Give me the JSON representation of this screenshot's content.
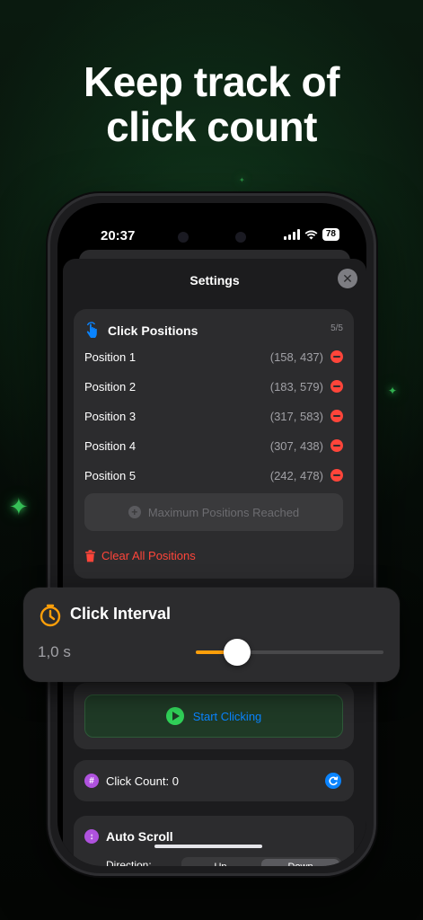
{
  "headline": {
    "line1": "Keep track of",
    "line2": "click count"
  },
  "status_bar": {
    "time": "20:37",
    "battery": "78"
  },
  "sheet": {
    "title": "Settings",
    "close_label": "✕"
  },
  "click_positions": {
    "title": "Click Positions",
    "count": "5/5",
    "items": [
      {
        "label": "Position 1",
        "coords": "(158, 437)"
      },
      {
        "label": "Position 2",
        "coords": "(183, 579)"
      },
      {
        "label": "Position 3",
        "coords": "(317, 583)"
      },
      {
        "label": "Position 4",
        "coords": "(307, 438)"
      },
      {
        "label": "Position 5",
        "coords": "(242, 478)"
      }
    ],
    "max_button": "Maximum Positions Reached",
    "clear_label": "Clear All Positions"
  },
  "start_button": {
    "label": "Start Clicking"
  },
  "click_count": {
    "label": "Click Count: 0"
  },
  "auto_scroll": {
    "title": "Auto Scroll",
    "direction_label": "Direction:",
    "options": [
      "Up",
      "Down"
    ],
    "selected": "Down"
  },
  "click_interval": {
    "title": "Click Interval",
    "value": "1,0 s",
    "slider_fraction": 0.22
  },
  "colors": {
    "accent_orange": "#ff9f0a",
    "accent_blue": "#0a84ff",
    "danger_red": "#ff453a",
    "success_green": "#30d158",
    "purple": "#af52de"
  }
}
